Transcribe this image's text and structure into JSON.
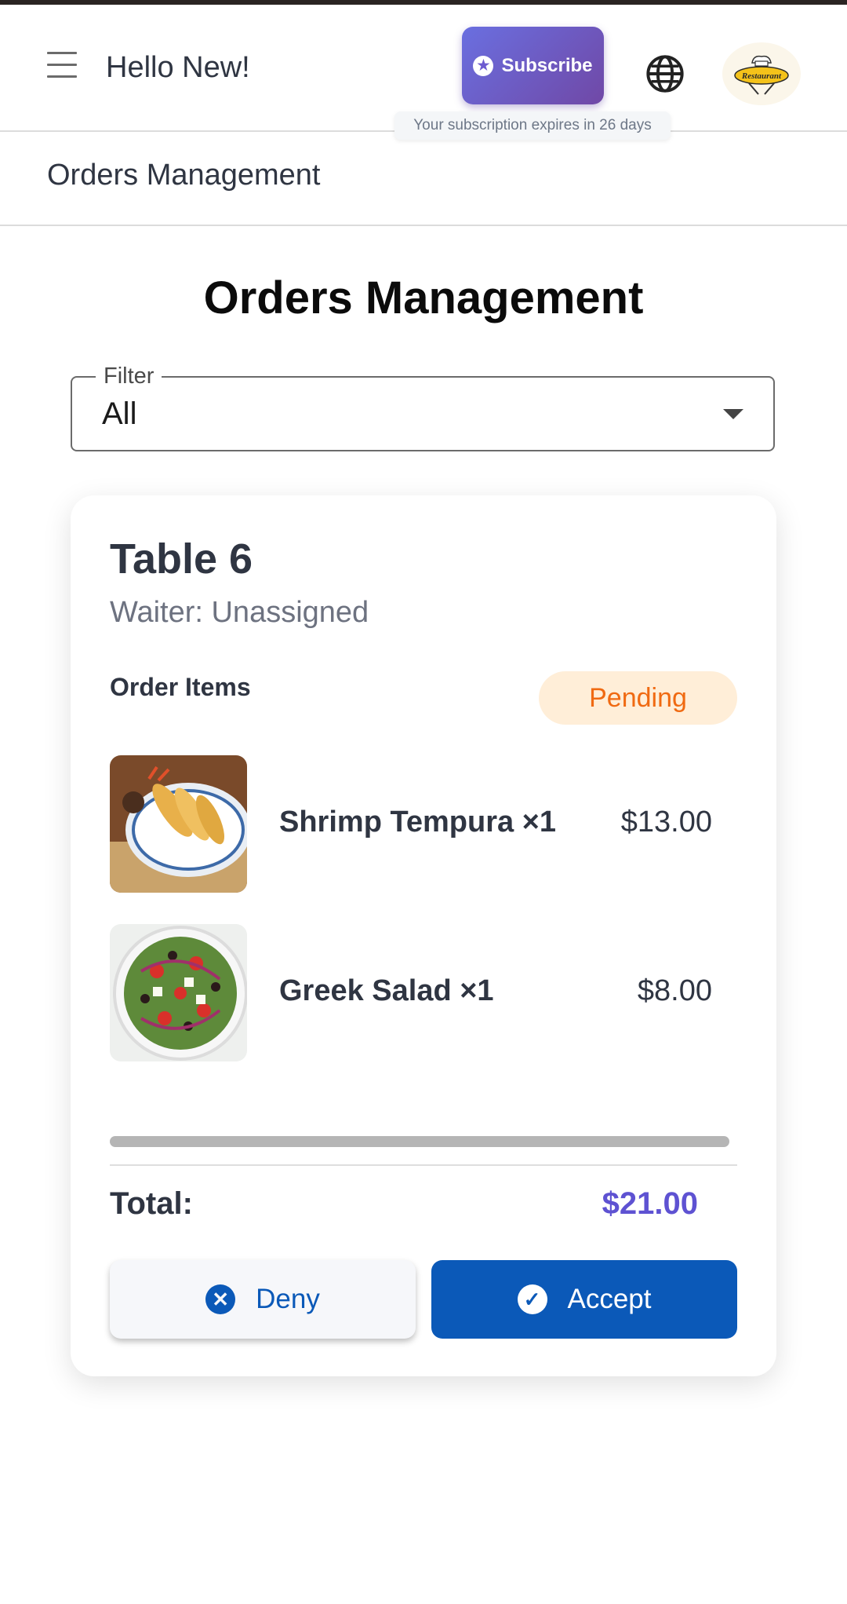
{
  "header": {
    "greeting": "Hello New!",
    "subscribe_label": "Subscribe",
    "subscription_notice": "Your subscription expires in 26 days",
    "logo_text": "Restaurant"
  },
  "breadcrumb": "Orders Management",
  "page_title": "Orders Management",
  "filter": {
    "label": "Filter",
    "value": "All"
  },
  "order": {
    "table": "Table 6",
    "waiter": "Waiter: Unassigned",
    "items_heading": "Order Items",
    "status": "Pending",
    "items": [
      {
        "name": "Shrimp Tempura ×1",
        "price": "$13.00",
        "image": "shrimp-tempura-photo"
      },
      {
        "name": "Greek Salad ×1",
        "price": "$8.00",
        "image": "greek-salad-photo"
      }
    ],
    "total_label": "Total:",
    "total_value": "$21.00",
    "deny_label": "Deny",
    "accept_label": "Accept"
  },
  "colors": {
    "primary": "#0b59b8",
    "total_accent": "#5e52d2",
    "pending_text": "#f06a12",
    "pending_bg": "#ffeed8",
    "subscribe_gradient_start": "#6a6fe0",
    "subscribe_gradient_end": "#7048a6"
  }
}
